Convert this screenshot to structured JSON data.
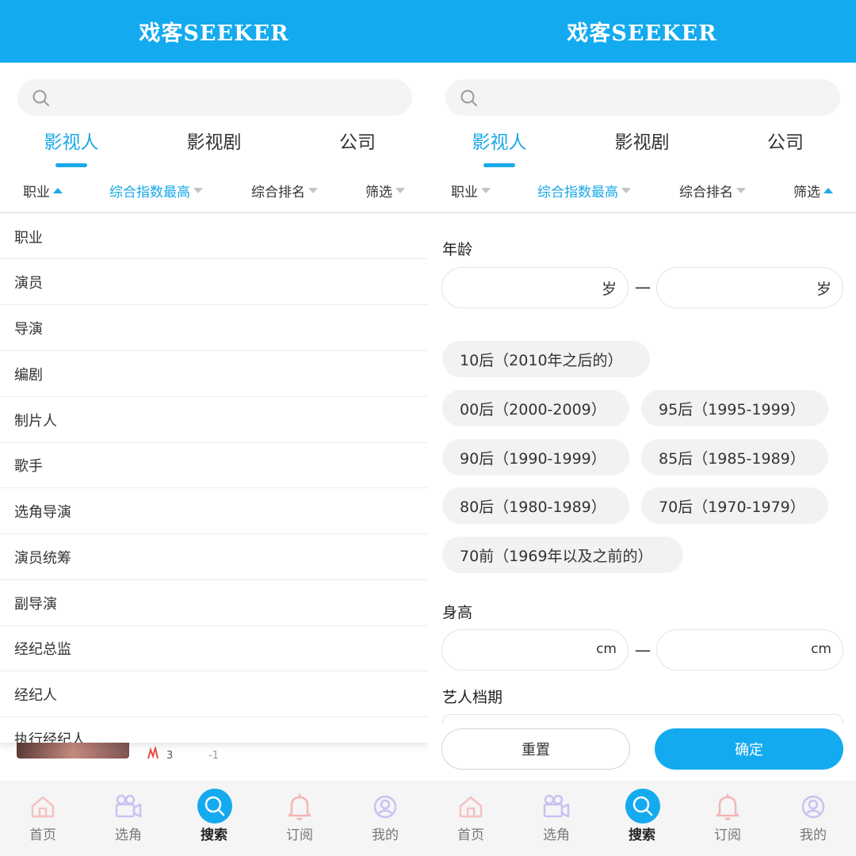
{
  "app": {
    "logo": "戏客SEEKER"
  },
  "colors": {
    "brand": "#14aaf0",
    "active_text": "#1aa8e8"
  },
  "search": {
    "placeholder": ""
  },
  "tabs": [
    {
      "label": "影视人",
      "active": true
    },
    {
      "label": "影视剧",
      "active": false
    },
    {
      "label": "公司",
      "active": false
    }
  ],
  "filters": {
    "left": [
      {
        "label": "职业",
        "arrow": "up"
      },
      {
        "label": "综合指数最高",
        "arrow": "down"
      },
      {
        "label": "综合排名",
        "arrow": "down"
      },
      {
        "label": "筛选",
        "arrow": "down"
      }
    ],
    "right": [
      {
        "label": "职业",
        "arrow": "down"
      },
      {
        "label": "综合指数最高",
        "arrow": "down"
      },
      {
        "label": "综合排名",
        "arrow": "down"
      },
      {
        "label": "筛选",
        "arrow": "up"
      }
    ]
  },
  "occupation_menu": [
    "职业",
    "演员",
    "导演",
    "编剧",
    "制片人",
    "歌手",
    "选角导演",
    "演员统筹",
    "副导演",
    "经纪总监",
    "经纪人",
    "执行经纪人"
  ],
  "list_peek": {
    "num_a": "3",
    "num_b": "-1"
  },
  "filter_panel": {
    "age_label": "年龄",
    "age_unit": "岁",
    "range_dash": "一",
    "age_chips": [
      "10后（2010年之后的）",
      "00后（2000-2009）",
      "95后（1995-1999）",
      "90后（1990-1999）",
      "85后（1985-1989）",
      "80后（1980-1989）",
      "70后（1970-1979）",
      "70前（1969年以及之前的）"
    ],
    "height_label": "身高",
    "height_unit": "cm",
    "schedule_label": "艺人档期",
    "reset_label": "重置",
    "confirm_label": "确定"
  },
  "nav": [
    {
      "label": "首页",
      "icon": "home-icon",
      "active": false
    },
    {
      "label": "选角",
      "icon": "camera-icon",
      "active": false
    },
    {
      "label": "搜索",
      "icon": "search-icon",
      "active": true
    },
    {
      "label": "订阅",
      "icon": "bell-icon",
      "active": false
    },
    {
      "label": "我的",
      "icon": "user-icon",
      "active": false
    }
  ]
}
